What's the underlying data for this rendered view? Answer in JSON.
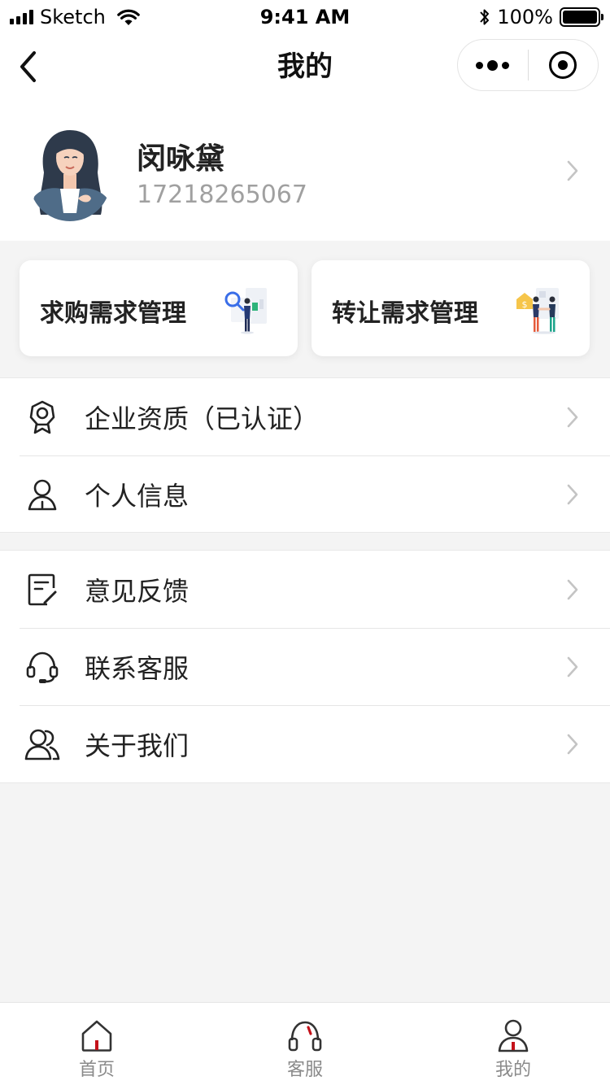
{
  "status_bar": {
    "carrier": "Sketch",
    "time": "9:41 AM",
    "battery": "100%"
  },
  "nav": {
    "title": "我的"
  },
  "profile": {
    "name": "闵咏黛",
    "phone": "17218265067"
  },
  "quick_cards": [
    {
      "label": "求购需求管理",
      "icon": "search-purchase-illustration"
    },
    {
      "label": "转让需求管理",
      "icon": "transfer-deal-illustration"
    }
  ],
  "menu_groups": [
    [
      {
        "label": "企业资质（已认证）",
        "icon": "certificate-icon"
      },
      {
        "label": "个人信息",
        "icon": "person-icon"
      }
    ],
    [
      {
        "label": "意见反馈",
        "icon": "feedback-icon"
      },
      {
        "label": "联系客服",
        "icon": "headset-icon"
      },
      {
        "label": "关于我们",
        "icon": "users-icon"
      }
    ]
  ],
  "tab_bar": [
    {
      "label": "首页",
      "icon": "home-icon"
    },
    {
      "label": "客服",
      "icon": "headset-icon"
    },
    {
      "label": "我的",
      "icon": "user-icon"
    }
  ],
  "colors": {
    "accent": "#c4121a",
    "background": "#f4f4f4",
    "text_primary": "#222222",
    "text_secondary": "#a0a0a0"
  }
}
